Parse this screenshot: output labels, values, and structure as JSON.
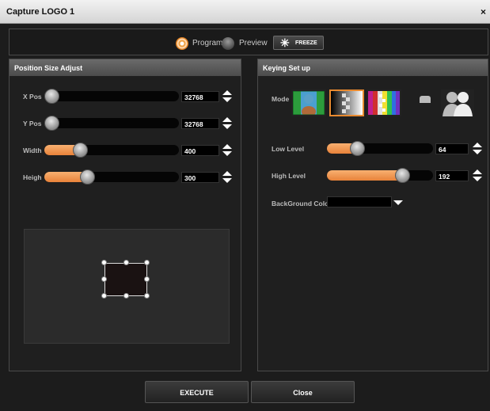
{
  "window": {
    "title": "Capture LOGO 1",
    "close_glyph": "×"
  },
  "source": {
    "options": [
      {
        "label": "Program",
        "selected": true
      },
      {
        "label": "Preview",
        "selected": false
      }
    ],
    "freeze_label": "FREEZE",
    "freeze_icon": "snowflake-icon"
  },
  "position_panel": {
    "title": "Position Size Adjust",
    "rows": [
      {
        "label": "X Pos",
        "value": "32768",
        "fraction": 0.0
      },
      {
        "label": "Y Pos",
        "value": "32768",
        "fraction": 0.0
      },
      {
        "label": "Width",
        "value": "400",
        "fraction": 0.24
      },
      {
        "label": "Heigh",
        "value": "300",
        "fraction": 0.3
      }
    ]
  },
  "keying_panel": {
    "title": "Keying Set up",
    "mode_label": "Mode",
    "modes": [
      "luma-key-mode",
      "alpha-gradient-mode",
      "chroma-key-mode"
    ],
    "selected_mode": 1,
    "rows": [
      {
        "label": "Low Level",
        "value": "64",
        "fraction": 0.25
      },
      {
        "label": "High Level",
        "value": "192",
        "fraction": 0.75
      }
    ],
    "background_label": "BackGround Color"
  },
  "buttons": {
    "execute": "EXECUTE",
    "close": "Close"
  },
  "colors": {
    "accent": "#e8823a",
    "panel_header": "#555555",
    "background": "#1c1c1c"
  }
}
